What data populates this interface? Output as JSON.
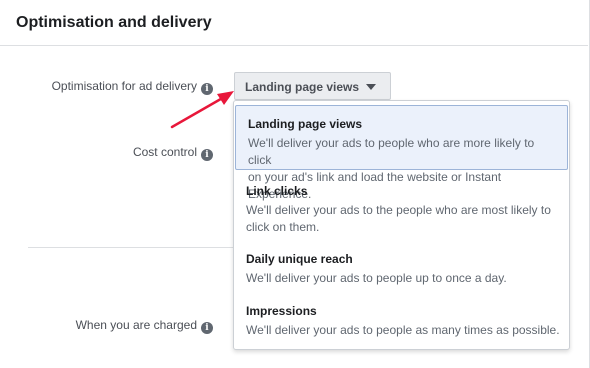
{
  "panel": {
    "title": "Optimisation and delivery"
  },
  "fields": {
    "optimisation_label": "Optimisation for ad delivery",
    "cost_control_label": "Cost control",
    "charged_label": "When you are charged",
    "info_glyph": "i"
  },
  "dropdown": {
    "selected": "Landing page views"
  },
  "menu": {
    "items": [
      {
        "title": "Landing page views",
        "desc_lines": [
          "We'll deliver your ads to people who are more likely to click",
          "on your ad's link and load the website or Instant Experience."
        ],
        "selected": true
      },
      {
        "title": "Link clicks",
        "desc_lines": [
          "We'll deliver your ads to the people who are most likely to",
          "click on them."
        ],
        "selected": false
      },
      {
        "title": "Daily unique reach",
        "desc_lines": [
          "We'll deliver your ads to people up to once a day."
        ],
        "selected": false
      },
      {
        "title": "Impressions",
        "desc_lines": [
          "We'll deliver your ads to people as many times as possible."
        ],
        "selected": false
      }
    ]
  },
  "colors": {
    "arrow": "#e8173a",
    "selected_bg": "#ebf1fb",
    "selected_border": "#9cb4d8"
  },
  "icons": {
    "info": "info-icon",
    "caret": "caret-down-icon",
    "annotation": "red-arrow-icon"
  }
}
